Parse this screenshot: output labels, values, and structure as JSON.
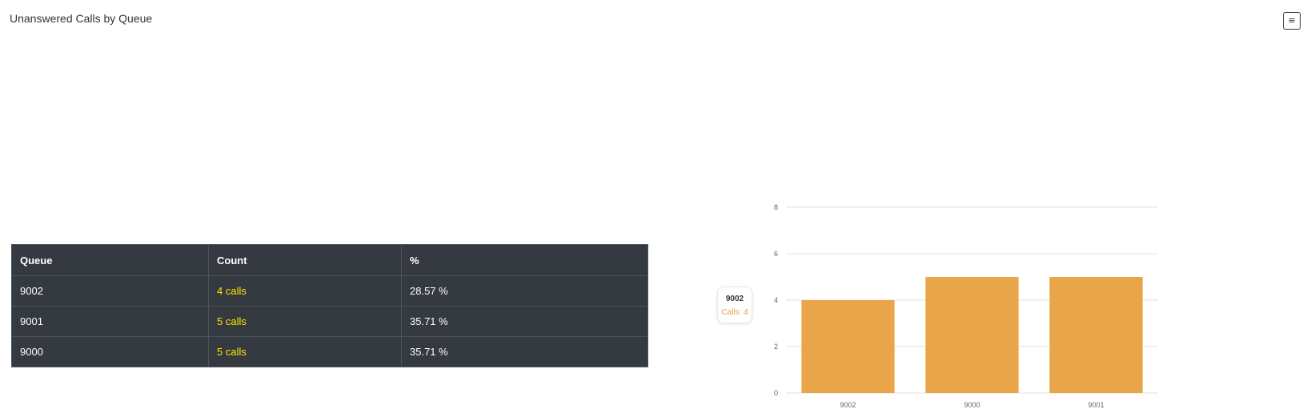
{
  "page": {
    "title": "Unanswered Calls by Queue",
    "menu_icon": "≡"
  },
  "table": {
    "headers": {
      "queue": "Queue",
      "count": "Count",
      "percent": "%"
    },
    "rows": [
      {
        "queue": "9002",
        "count": "4 calls",
        "percent": "28.57 %"
      },
      {
        "queue": "9001",
        "count": "5 calls",
        "percent": "35.71 %"
      },
      {
        "queue": "9000",
        "count": "5 calls",
        "percent": "35.71 %"
      }
    ]
  },
  "tooltip": {
    "title": "9002",
    "value": "Calls: 4"
  },
  "chart_data": {
    "type": "bar",
    "categories": [
      "9002",
      "9000",
      "9001"
    ],
    "series": [
      {
        "values": [
          4,
          5,
          5
        ]
      }
    ],
    "ylim": [
      0,
      8
    ],
    "yticks": [
      0,
      2,
      4,
      6,
      8
    ],
    "bar_color": "#e8a54a",
    "grid": true,
    "legend": "none"
  }
}
